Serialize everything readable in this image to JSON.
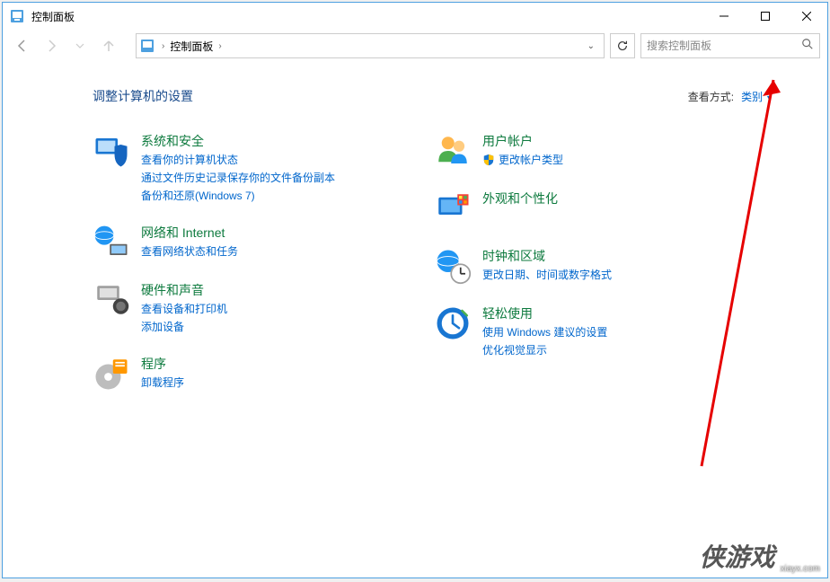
{
  "window": {
    "title": "控制面板"
  },
  "navbar": {
    "breadcrumb": "控制面板",
    "search_placeholder": "搜索控制面板"
  },
  "header": {
    "heading": "调整计算机的设置",
    "view_by_label": "查看方式:",
    "view_by_value": "类别"
  },
  "categories": {
    "left": [
      {
        "title": "系统和安全",
        "links": [
          "查看你的计算机状态",
          "通过文件历史记录保存你的文件备份副本",
          "备份和还原(Windows 7)"
        ],
        "icon": "system-security"
      },
      {
        "title": "网络和 Internet",
        "links": [
          "查看网络状态和任务"
        ],
        "icon": "network"
      },
      {
        "title": "硬件和声音",
        "links": [
          "查看设备和打印机",
          "添加设备"
        ],
        "icon": "hardware"
      },
      {
        "title": "程序",
        "links": [
          "卸载程序"
        ],
        "icon": "programs"
      }
    ],
    "right": [
      {
        "title": "用户帐户",
        "links": [
          "更改帐户类型"
        ],
        "shield": true,
        "icon": "users"
      },
      {
        "title": "外观和个性化",
        "links": [],
        "icon": "appearance"
      },
      {
        "title": "时钟和区域",
        "links": [
          "更改日期、时间或数字格式"
        ],
        "icon": "clock"
      },
      {
        "title": "轻松使用",
        "links": [
          "使用 Windows 建议的设置",
          "优化视觉显示"
        ],
        "icon": "ease"
      }
    ]
  },
  "watermark": {
    "logo": "侠游戏",
    "url": "xiayx.com"
  }
}
